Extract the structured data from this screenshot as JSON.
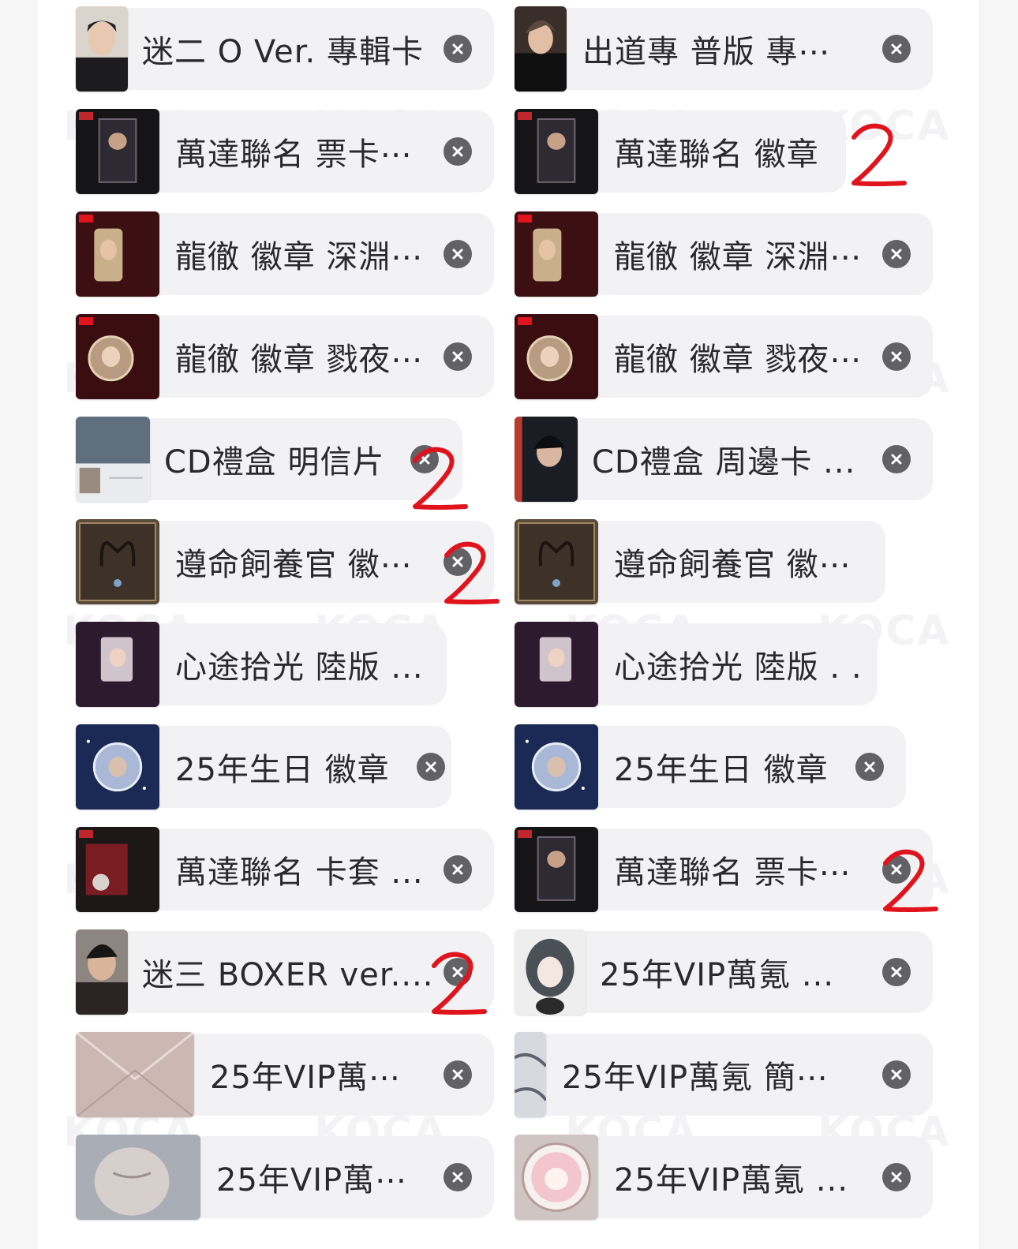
{
  "items_left": [
    {
      "label": "迷二 O Ver. 專輯卡",
      "thumb": "portrait-light"
    },
    {
      "label": "萬達聯名 票卡⋯",
      "thumb": "dark-card"
    },
    {
      "label": "龍徹 徽章 深淵⋯",
      "thumb": "red-card"
    },
    {
      "label": "龍徹 徽章 戮夜⋯",
      "thumb": "red-round"
    },
    {
      "label": "CD禮盒 明信片",
      "thumb": "postcard"
    },
    {
      "label": "遵命飼養官 徽⋯",
      "thumb": "brown-frame"
    },
    {
      "label": "心途拾光 陸版 ...",
      "thumb": "purple-card"
    },
    {
      "label": "25年生日 徽章",
      "thumb": "blue-round"
    },
    {
      "label": "萬達聯名 卡套 ...",
      "thumb": "dark-sleeve"
    },
    {
      "label": "迷三 BOXER ver....",
      "thumb": "portrait-dark"
    },
    {
      "label": "25年VIP萬⋯",
      "thumb": "envelope"
    },
    {
      "label": "25年VIP萬⋯",
      "thumb": "body-art"
    }
  ],
  "items_right": [
    {
      "label": "出道專 普版 專⋯",
      "thumb": "portrait-suit"
    },
    {
      "label": "萬達聯名 徽章",
      "thumb": "dark-card"
    },
    {
      "label": "龍徹 徽章 深淵⋯",
      "thumb": "red-card"
    },
    {
      "label": "龍徹 徽章 戮夜⋯",
      "thumb": "red-round"
    },
    {
      "label": "CD禮盒 周邊卡 ...",
      "thumb": "dark-portrait"
    },
    {
      "label": "遵命飼養官 徽⋯",
      "thumb": "brown-frame"
    },
    {
      "label": "心途拾光 陸版 . .",
      "thumb": "purple-card"
    },
    {
      "label": "25年生日 徽章",
      "thumb": "blue-round"
    },
    {
      "label": "萬達聯名 票卡⋯",
      "thumb": "dark-card"
    },
    {
      "label": "25年VIP萬氪 ...",
      "thumb": "plush"
    },
    {
      "label": "25年VIP萬氪 簡⋯",
      "thumb": "marble"
    },
    {
      "label": "25年VIP萬氪 ...",
      "thumb": "pink-round"
    }
  ],
  "annotations": {
    "mark_text": "2"
  },
  "watermark": {
    "text": "KOCA"
  },
  "colors": {
    "chip_bg": "#f2f2f4",
    "label_text": "#2a2a2e",
    "close_bg": "#616166",
    "annotation_red": "#e0141c"
  }
}
